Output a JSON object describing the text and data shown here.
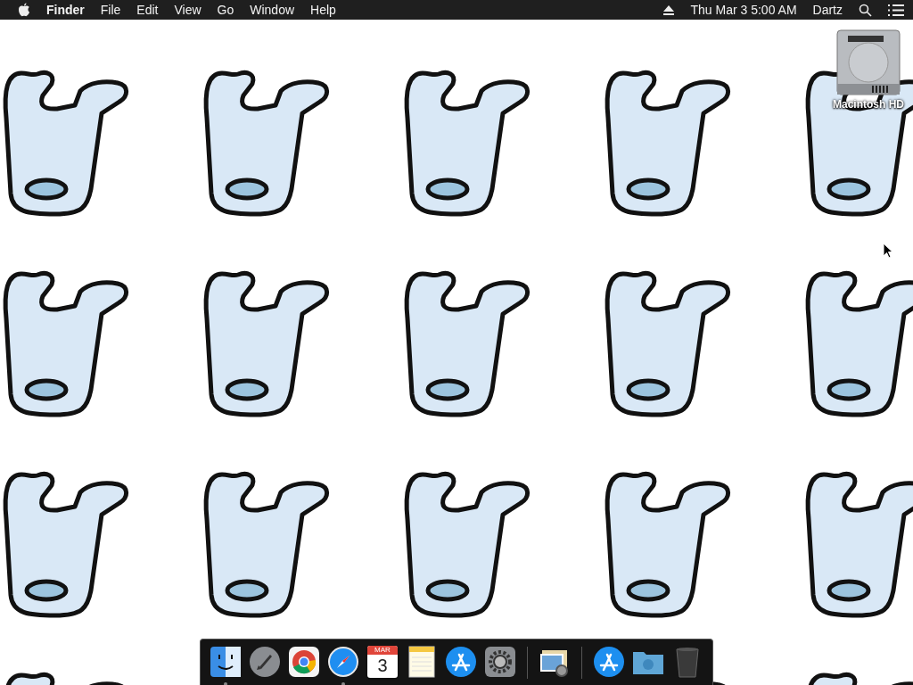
{
  "menu_bar": {
    "app_name": "Finder",
    "menus": [
      "File",
      "Edit",
      "View",
      "Go",
      "Window",
      "Help"
    ],
    "clock": "Thu Mar 3  5:00 AM",
    "user": "Dartz"
  },
  "desktop_icons": [
    {
      "kind": "drive",
      "label": "Macintosh HD"
    }
  ],
  "dock": {
    "items": [
      {
        "kind": "finder",
        "running": true
      },
      {
        "kind": "launchpad",
        "running": false
      },
      {
        "kind": "chrome",
        "running": false
      },
      {
        "kind": "safari",
        "running": true
      },
      {
        "kind": "calendar",
        "running": false,
        "month": "MAR",
        "day": "3"
      },
      {
        "kind": "notes",
        "running": false
      },
      {
        "kind": "appstore",
        "running": false
      },
      {
        "kind": "settings",
        "running": false
      },
      {
        "kind": "separator"
      },
      {
        "kind": "preview",
        "running": false
      },
      {
        "kind": "separator"
      },
      {
        "kind": "appstore",
        "running": false
      },
      {
        "kind": "folder",
        "running": false
      },
      {
        "kind": "trash",
        "running": false
      }
    ]
  }
}
